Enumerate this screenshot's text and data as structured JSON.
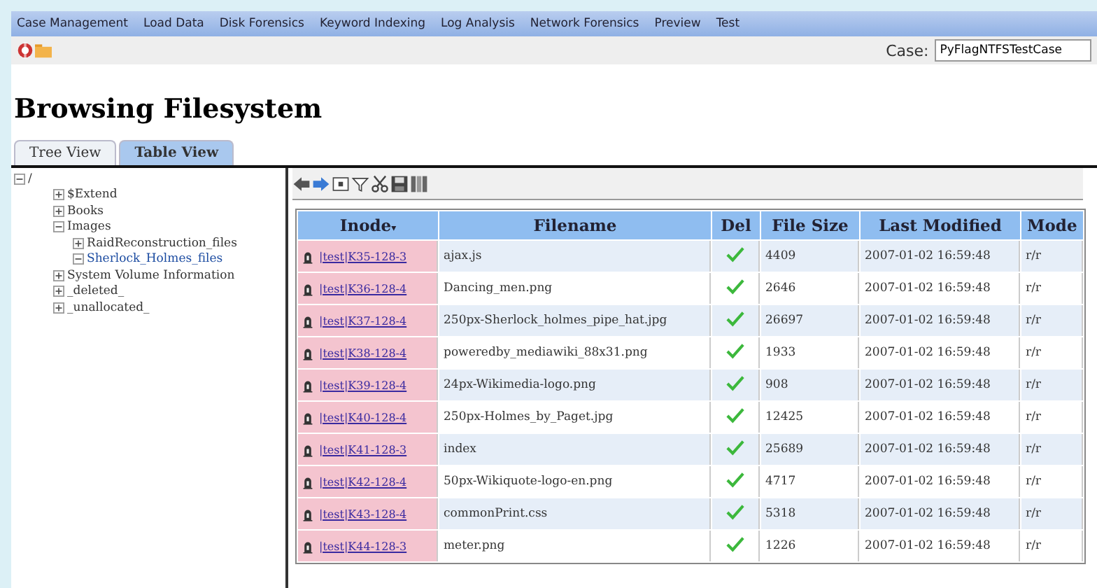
{
  "menu": [
    "Case Management",
    "Load Data",
    "Disk Forensics",
    "Keyword Indexing",
    "Log Analysis",
    "Network Forensics",
    "Preview",
    "Test"
  ],
  "case": {
    "label": "Case:",
    "value": "PyFlagNTFSTestCase"
  },
  "title": "Browsing Filesystem",
  "tabs": [
    {
      "label": "Tree View",
      "selected": false
    },
    {
      "label": "Table View",
      "selected": true
    }
  ],
  "tree": [
    {
      "label": "/",
      "expanded": true,
      "selected": false,
      "children": [
        {
          "label": "$Extend",
          "expanded": false,
          "selected": false
        },
        {
          "label": "Books",
          "expanded": false,
          "selected": false
        },
        {
          "label": "Images",
          "expanded": true,
          "selected": false,
          "children": [
            {
              "label": "RaidReconstruction_files",
              "expanded": false,
              "selected": false
            },
            {
              "label": "Sherlock_Holmes_files",
              "expanded": true,
              "selected": true
            }
          ]
        },
        {
          "label": "System Volume Information",
          "expanded": false,
          "selected": false
        },
        {
          "label": "_deleted_",
          "expanded": false,
          "selected": false
        },
        {
          "label": "_unallocated_",
          "expanded": false,
          "selected": false
        }
      ]
    }
  ],
  "table": {
    "columns": [
      "Inode",
      "Filename",
      "Del",
      "File Size",
      "Last Modified",
      "Mode"
    ],
    "sort_mark": "▾",
    "rows": [
      {
        "inode": "|test|K35-128-3",
        "filename": "ajax.js",
        "deleted": true,
        "size": "4409",
        "modified": "2007-01-02 16:59:48",
        "mode": "r/r"
      },
      {
        "inode": "|test|K36-128-4",
        "filename": "Dancing_men.png",
        "deleted": true,
        "size": "2646",
        "modified": "2007-01-02 16:59:48",
        "mode": "r/r"
      },
      {
        "inode": "|test|K37-128-4",
        "filename": "250px-Sherlock_holmes_pipe_hat.jpg",
        "deleted": true,
        "size": "26697",
        "modified": "2007-01-02 16:59:48",
        "mode": "r/r"
      },
      {
        "inode": "|test|K38-128-4",
        "filename": "poweredby_mediawiki_88x31.png",
        "deleted": true,
        "size": "1933",
        "modified": "2007-01-02 16:59:48",
        "mode": "r/r"
      },
      {
        "inode": "|test|K39-128-4",
        "filename": "24px-Wikimedia-logo.png",
        "deleted": true,
        "size": "908",
        "modified": "2007-01-02 16:59:48",
        "mode": "r/r"
      },
      {
        "inode": "|test|K40-128-4",
        "filename": "250px-Holmes_by_Paget.jpg",
        "deleted": true,
        "size": "12425",
        "modified": "2007-01-02 16:59:48",
        "mode": "r/r"
      },
      {
        "inode": "|test|K41-128-3",
        "filename": "index",
        "deleted": true,
        "size": "25689",
        "modified": "2007-01-02 16:59:48",
        "mode": "r/r"
      },
      {
        "inode": "|test|K42-128-4",
        "filename": "50px-Wikiquote-logo-en.png",
        "deleted": true,
        "size": "4717",
        "modified": "2007-01-02 16:59:48",
        "mode": "r/r"
      },
      {
        "inode": "|test|K43-128-4",
        "filename": "commonPrint.css",
        "deleted": true,
        "size": "5318",
        "modified": "2007-01-02 16:59:48",
        "mode": "r/r"
      },
      {
        "inode": "|test|K44-128-3",
        "filename": "meter.png",
        "deleted": true,
        "size": "1226",
        "modified": "2007-01-02 16:59:48",
        "mode": "r/r"
      }
    ]
  }
}
